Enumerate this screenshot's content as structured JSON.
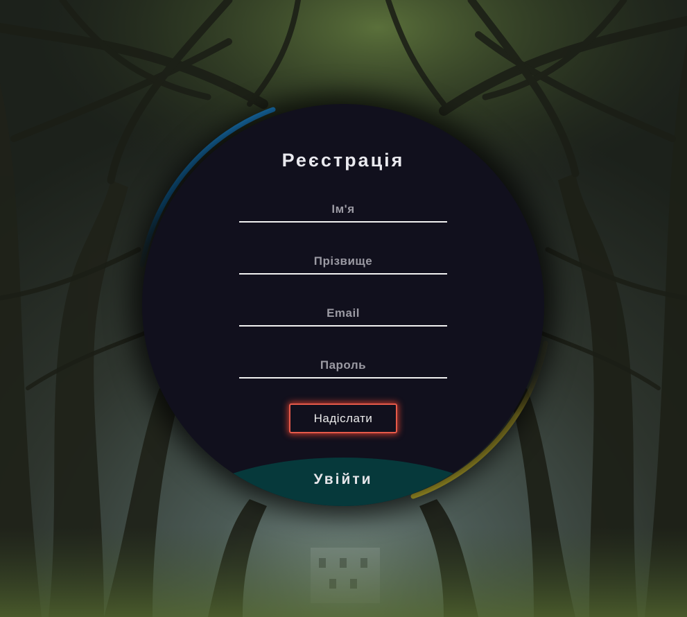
{
  "form": {
    "title": "Реєстрація",
    "fields": {
      "first_name": {
        "placeholder": "Ім'я",
        "value": ""
      },
      "last_name": {
        "placeholder": "Прізвище",
        "value": ""
      },
      "email": {
        "placeholder": "Email",
        "value": ""
      },
      "password": {
        "placeholder": "Пароль",
        "value": ""
      }
    },
    "submit_label": "Надіслати",
    "login_label": "Увійти"
  },
  "colors": {
    "card_background": "#11101d",
    "arc_blue": "#1e90e0",
    "arc_yellow": "#ecd933",
    "submit_glow": "#e65a4a",
    "login_background": "#06393b"
  }
}
